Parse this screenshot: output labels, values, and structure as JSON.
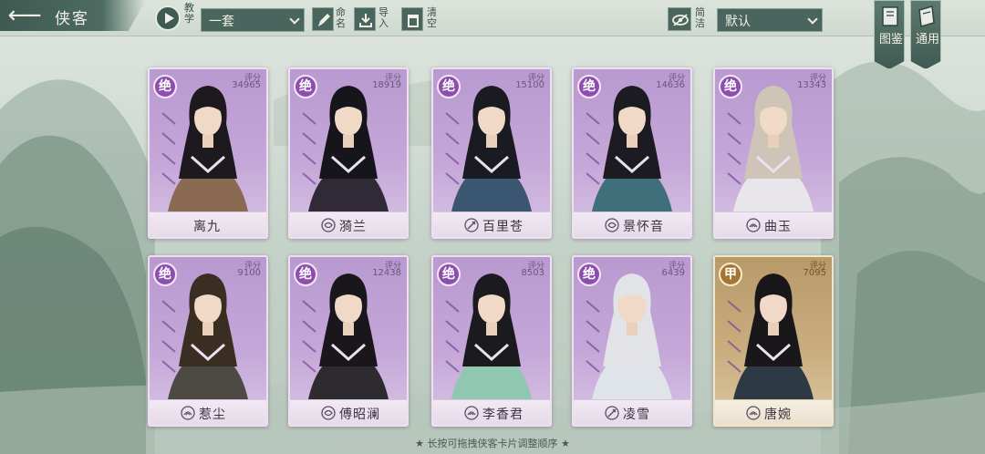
{
  "header": {
    "title": "侠客",
    "tutorial_label": "教学",
    "preset_select": "一套",
    "rename_label": "命名",
    "import_label": "导入",
    "clear_label": "清空",
    "simple_label": "简洁",
    "sort_select": "默认",
    "catalog_label": "图鉴",
    "general_label": "通用"
  },
  "cards": [
    {
      "rank": "绝",
      "score_label": "评分",
      "score": "34965",
      "name": "离九",
      "faction_icon": "none",
      "tier": "purple"
    },
    {
      "rank": "绝",
      "score_label": "评分",
      "score": "18919",
      "name": "漪兰",
      "faction_icon": "swirl-icon",
      "tier": "purple"
    },
    {
      "rank": "绝",
      "score_label": "评分",
      "score": "15100",
      "name": "百里苍",
      "faction_icon": "sword-icon",
      "tier": "purple"
    },
    {
      "rank": "绝",
      "score_label": "评分",
      "score": "14636",
      "name": "景怀音",
      "faction_icon": "swirl-icon",
      "tier": "purple"
    },
    {
      "rank": "绝",
      "score_label": "评分",
      "score": "13343",
      "name": "曲玉",
      "faction_icon": "lotus-icon",
      "tier": "purple"
    },
    {
      "rank": "绝",
      "score_label": "评分",
      "score": "9100",
      "name": "惹尘",
      "faction_icon": "lotus-icon",
      "tier": "purple"
    },
    {
      "rank": "绝",
      "score_label": "评分",
      "score": "12438",
      "name": "傅昭澜",
      "faction_icon": "swirl-icon",
      "tier": "purple"
    },
    {
      "rank": "绝",
      "score_label": "评分",
      "score": "8503",
      "name": "李香君",
      "faction_icon": "lotus-icon",
      "tier": "purple"
    },
    {
      "rank": "绝",
      "score_label": "评分",
      "score": "6439",
      "name": "凌雪",
      "faction_icon": "sword-icon",
      "tier": "purple"
    },
    {
      "rank": "甲",
      "score_label": "评分",
      "score": "7095",
      "name": "唐婉",
      "faction_icon": "lotus-icon",
      "tier": "gold"
    }
  ],
  "footer": {
    "hint": "★ 长按可拖拽侠客卡片调整顺序 ★"
  },
  "colors": {
    "accent": "#4a655d",
    "card_purple": "#c4a6d8",
    "card_gold": "#c9ad7e",
    "rank_purple": "#8d4fae",
    "rank_gold": "#a57631"
  }
}
